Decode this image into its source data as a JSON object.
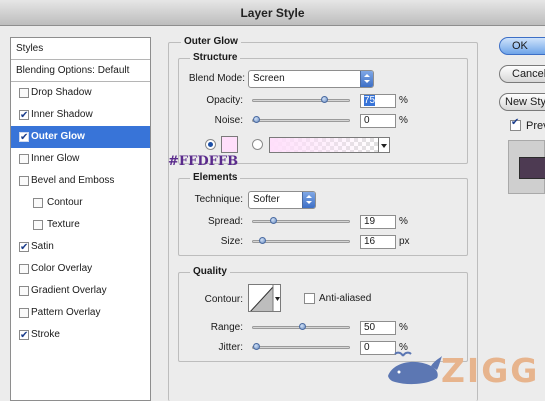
{
  "window": {
    "title": "Layer Style"
  },
  "sidebar": {
    "header": "Styles",
    "blending": "Blending Options: Default",
    "items": [
      {
        "label": "Drop Shadow",
        "checked": false
      },
      {
        "label": "Inner Shadow",
        "checked": true
      },
      {
        "label": "Outer Glow",
        "checked": true,
        "selected": true
      },
      {
        "label": "Inner Glow",
        "checked": false
      },
      {
        "label": "Bevel and Emboss",
        "checked": false
      },
      {
        "label": "Contour",
        "checked": false,
        "sub": true
      },
      {
        "label": "Texture",
        "checked": false,
        "sub": true
      },
      {
        "label": "Satin",
        "checked": true
      },
      {
        "label": "Color Overlay",
        "checked": false
      },
      {
        "label": "Gradient Overlay",
        "checked": false
      },
      {
        "label": "Pattern Overlay",
        "checked": false
      },
      {
        "label": "Stroke",
        "checked": true
      }
    ]
  },
  "panel": {
    "title": "Outer Glow",
    "structure": {
      "title": "Structure",
      "blend_mode_label": "Blend Mode:",
      "blend_mode": "Screen",
      "opacity_label": "Opacity:",
      "opacity": "75",
      "opacity_unit": "%",
      "noise_label": "Noise:",
      "noise": "0",
      "noise_unit": "%",
      "color": "#FFDFFB",
      "color_label": "#FFDFFB"
    },
    "elements": {
      "title": "Elements",
      "technique_label": "Technique:",
      "technique": "Softer",
      "spread_label": "Spread:",
      "spread": "19",
      "spread_unit": "%",
      "size_label": "Size:",
      "size": "16",
      "size_unit": "px"
    },
    "quality": {
      "title": "Quality",
      "contour_label": "Contour:",
      "anti_aliased_label": "Anti-aliased",
      "anti_aliased": false,
      "range_label": "Range:",
      "range": "50",
      "range_unit": "%",
      "jitter_label": "Jitter:",
      "jitter": "0",
      "jitter_unit": "%"
    }
  },
  "buttons": {
    "ok": "OK",
    "cancel": "Cancel",
    "new_style": "New Style...",
    "preview_label": "Preview",
    "preview_checked": true
  },
  "watermark": {
    "text": "ZIGG"
  }
}
